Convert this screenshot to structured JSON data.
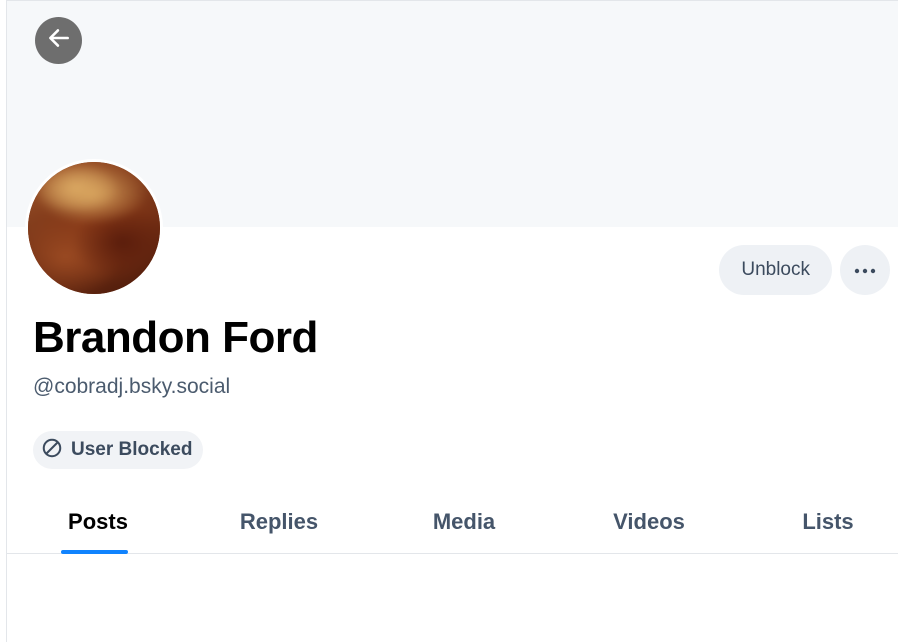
{
  "profile": {
    "display_name": "Brandon Ford",
    "handle": "@cobradj.bsky.social",
    "status_badge": "User Blocked"
  },
  "actions": {
    "unblock_label": "Unblock",
    "more_icon": "ellipsis-icon",
    "back_icon": "arrow-left-icon"
  },
  "tabs": [
    {
      "label": "Posts",
      "active": true
    },
    {
      "label": "Replies",
      "active": false
    },
    {
      "label": "Media",
      "active": false
    },
    {
      "label": "Videos",
      "active": false
    },
    {
      "label": "Lists",
      "active": false
    }
  ],
  "colors": {
    "accent": "#1083fe",
    "banner": "#f6f8fa",
    "button_bg": "#eef1f5",
    "muted_text": "#4b5b6e"
  }
}
